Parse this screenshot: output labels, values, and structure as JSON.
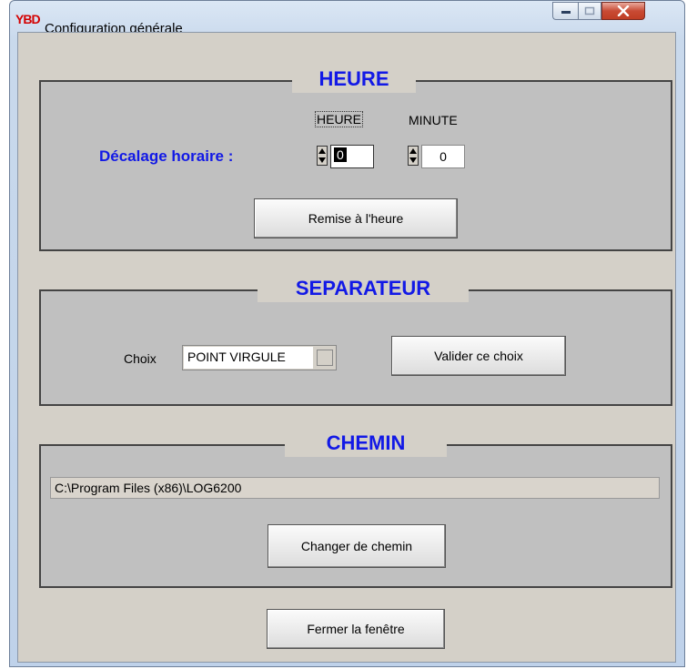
{
  "window": {
    "title": "Configuration générale",
    "app_icon_text": "YBD"
  },
  "caption_buttons": {
    "minimize": "minimize-icon",
    "maximize": "maximize-icon",
    "close": "close-icon"
  },
  "colors": {
    "legend_text": "#1219e6",
    "group_bg": "#c0c0c0",
    "window_bg": "#d4d0c8",
    "close_button": "#c84b35"
  },
  "heure": {
    "legend": "HEURE",
    "hour_header": "HEURE",
    "minute_header": "MINUTE",
    "offset_label": "Décalage horaire :",
    "hour_value": "0",
    "minute_value": "0",
    "reset_button": "Remise à l'heure"
  },
  "separateur": {
    "legend": "SEPARATEUR",
    "choice_label": "Choix",
    "choice_value": "POINT VIRGULE",
    "validate_button": "Valider ce choix"
  },
  "chemin": {
    "legend": "CHEMIN",
    "path_value": "C:\\Program Files (x86)\\LOG6200",
    "change_button": "Changer de chemin"
  },
  "close_window_button": "Fermer la fenêtre"
}
